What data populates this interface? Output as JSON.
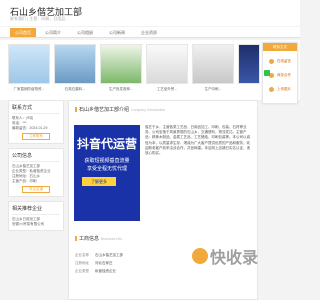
{
  "header": {
    "title": "石山乡偕艺加工部",
    "subtitle": "联系我们 | 主营：印刷，日用品..."
  },
  "nav": [
    "公司首页",
    "公司简介",
    "公司相册",
    "公司新闻",
    "企业资质"
  ],
  "banners": [
    {
      "caption": "厂家直销防疫物资..."
    },
    {
      "caption": "石英石磨料..."
    },
    {
      "caption": "生产批发各种..."
    },
    {
      "caption": "工艺品外贸..."
    },
    {
      "caption": "生产印刷..."
    },
    {
      "caption": "厂家供应..."
    }
  ],
  "side_popup": {
    "head": "联系方式",
    "btn1": "在线留言",
    "btn2": "商务合作",
    "btn3": "上传图片"
  },
  "contact": {
    "title": "联系方式",
    "line1": "联系人：卢晓",
    "line2": "电话：***",
    "line3": "最新留言：2024-01-29",
    "button": "立即联系"
  },
  "company": {
    "title": "公司信息",
    "line1": "石山乡偕艺加工部",
    "line2": "企业类型：私营独资企业",
    "line3": "注册地址：石山乡",
    "line4": "主营产品：印刷",
    "button": "关注店铺"
  },
  "related": {
    "title": "相关推荐企业",
    "line1": "石山乡日用加工部",
    "line2": "安徽××贸易有限公司"
  },
  "main": {
    "intro_title": "石山乡偕艺加工部介绍",
    "intro_en": "Company Introduction",
    "intro_text": "偕艺于乡，主营各类工艺品、日用品加工、印刷、包装、石材等业务。公司坐落于风景秀丽的石山乡，交通便利，物流发达。主营产品：精美木制品、金属工艺品、工艺蜡烛、印刷包装等。本公司以诚信为本，以质量求生存，竭诚为广大客户提供优质的产品和服务，欢迎新老客户前来洽谈合作，共创辉煌。本店网上店铺已实名认证，请放心购买。",
    "promo_big": "抖音代运营",
    "promo_l2": "获取短视频垂直流量",
    "promo_l3": "享受全程无忧代理",
    "promo_cta": "了解更多",
    "biz_title": "工商信息",
    "biz_en": "Business Info",
    "biz_rows": [
      {
        "k": "企业名称",
        "v": "石山乡偕艺加工部"
      },
      {
        "k": "注册地址",
        "v": "河北石家庄"
      },
      {
        "k": "企业类型",
        "v": "私营独资企业"
      }
    ]
  },
  "watermark": "快收录",
  "colors": {
    "accent": "#f2a93b",
    "promo_bg": "#1a32a8"
  }
}
